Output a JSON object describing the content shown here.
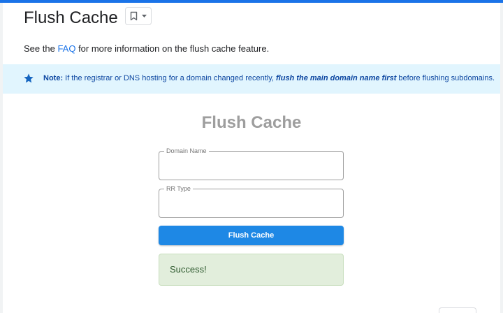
{
  "colors": {
    "accent": "#1a73e8",
    "note_bg": "#e1f5fe",
    "button": "#1e88e5",
    "success_bg": "#e2eedc"
  },
  "page": {
    "title": "Flush Cache",
    "bookmark_icon": "bookmark-icon",
    "dropdown_icon": "arrow-drop-down-icon"
  },
  "intro": {
    "prefix": "See the ",
    "link": "FAQ",
    "suffix": " for more information on the flush cache feature."
  },
  "note": {
    "icon": "star-icon",
    "label": "Note:",
    "text_before": " If the registrar or DNS hosting for a domain changed recently, ",
    "emphasis": "flush the main domain name first",
    "text_after": " before flushing subdomains."
  },
  "form": {
    "title": "Flush Cache",
    "domain_label": "Domain Name",
    "domain_value": "",
    "rrtype_label": "RR Type",
    "rrtype_value": "",
    "submit_label": "Flush Cache"
  },
  "status": {
    "message": "Success!"
  }
}
